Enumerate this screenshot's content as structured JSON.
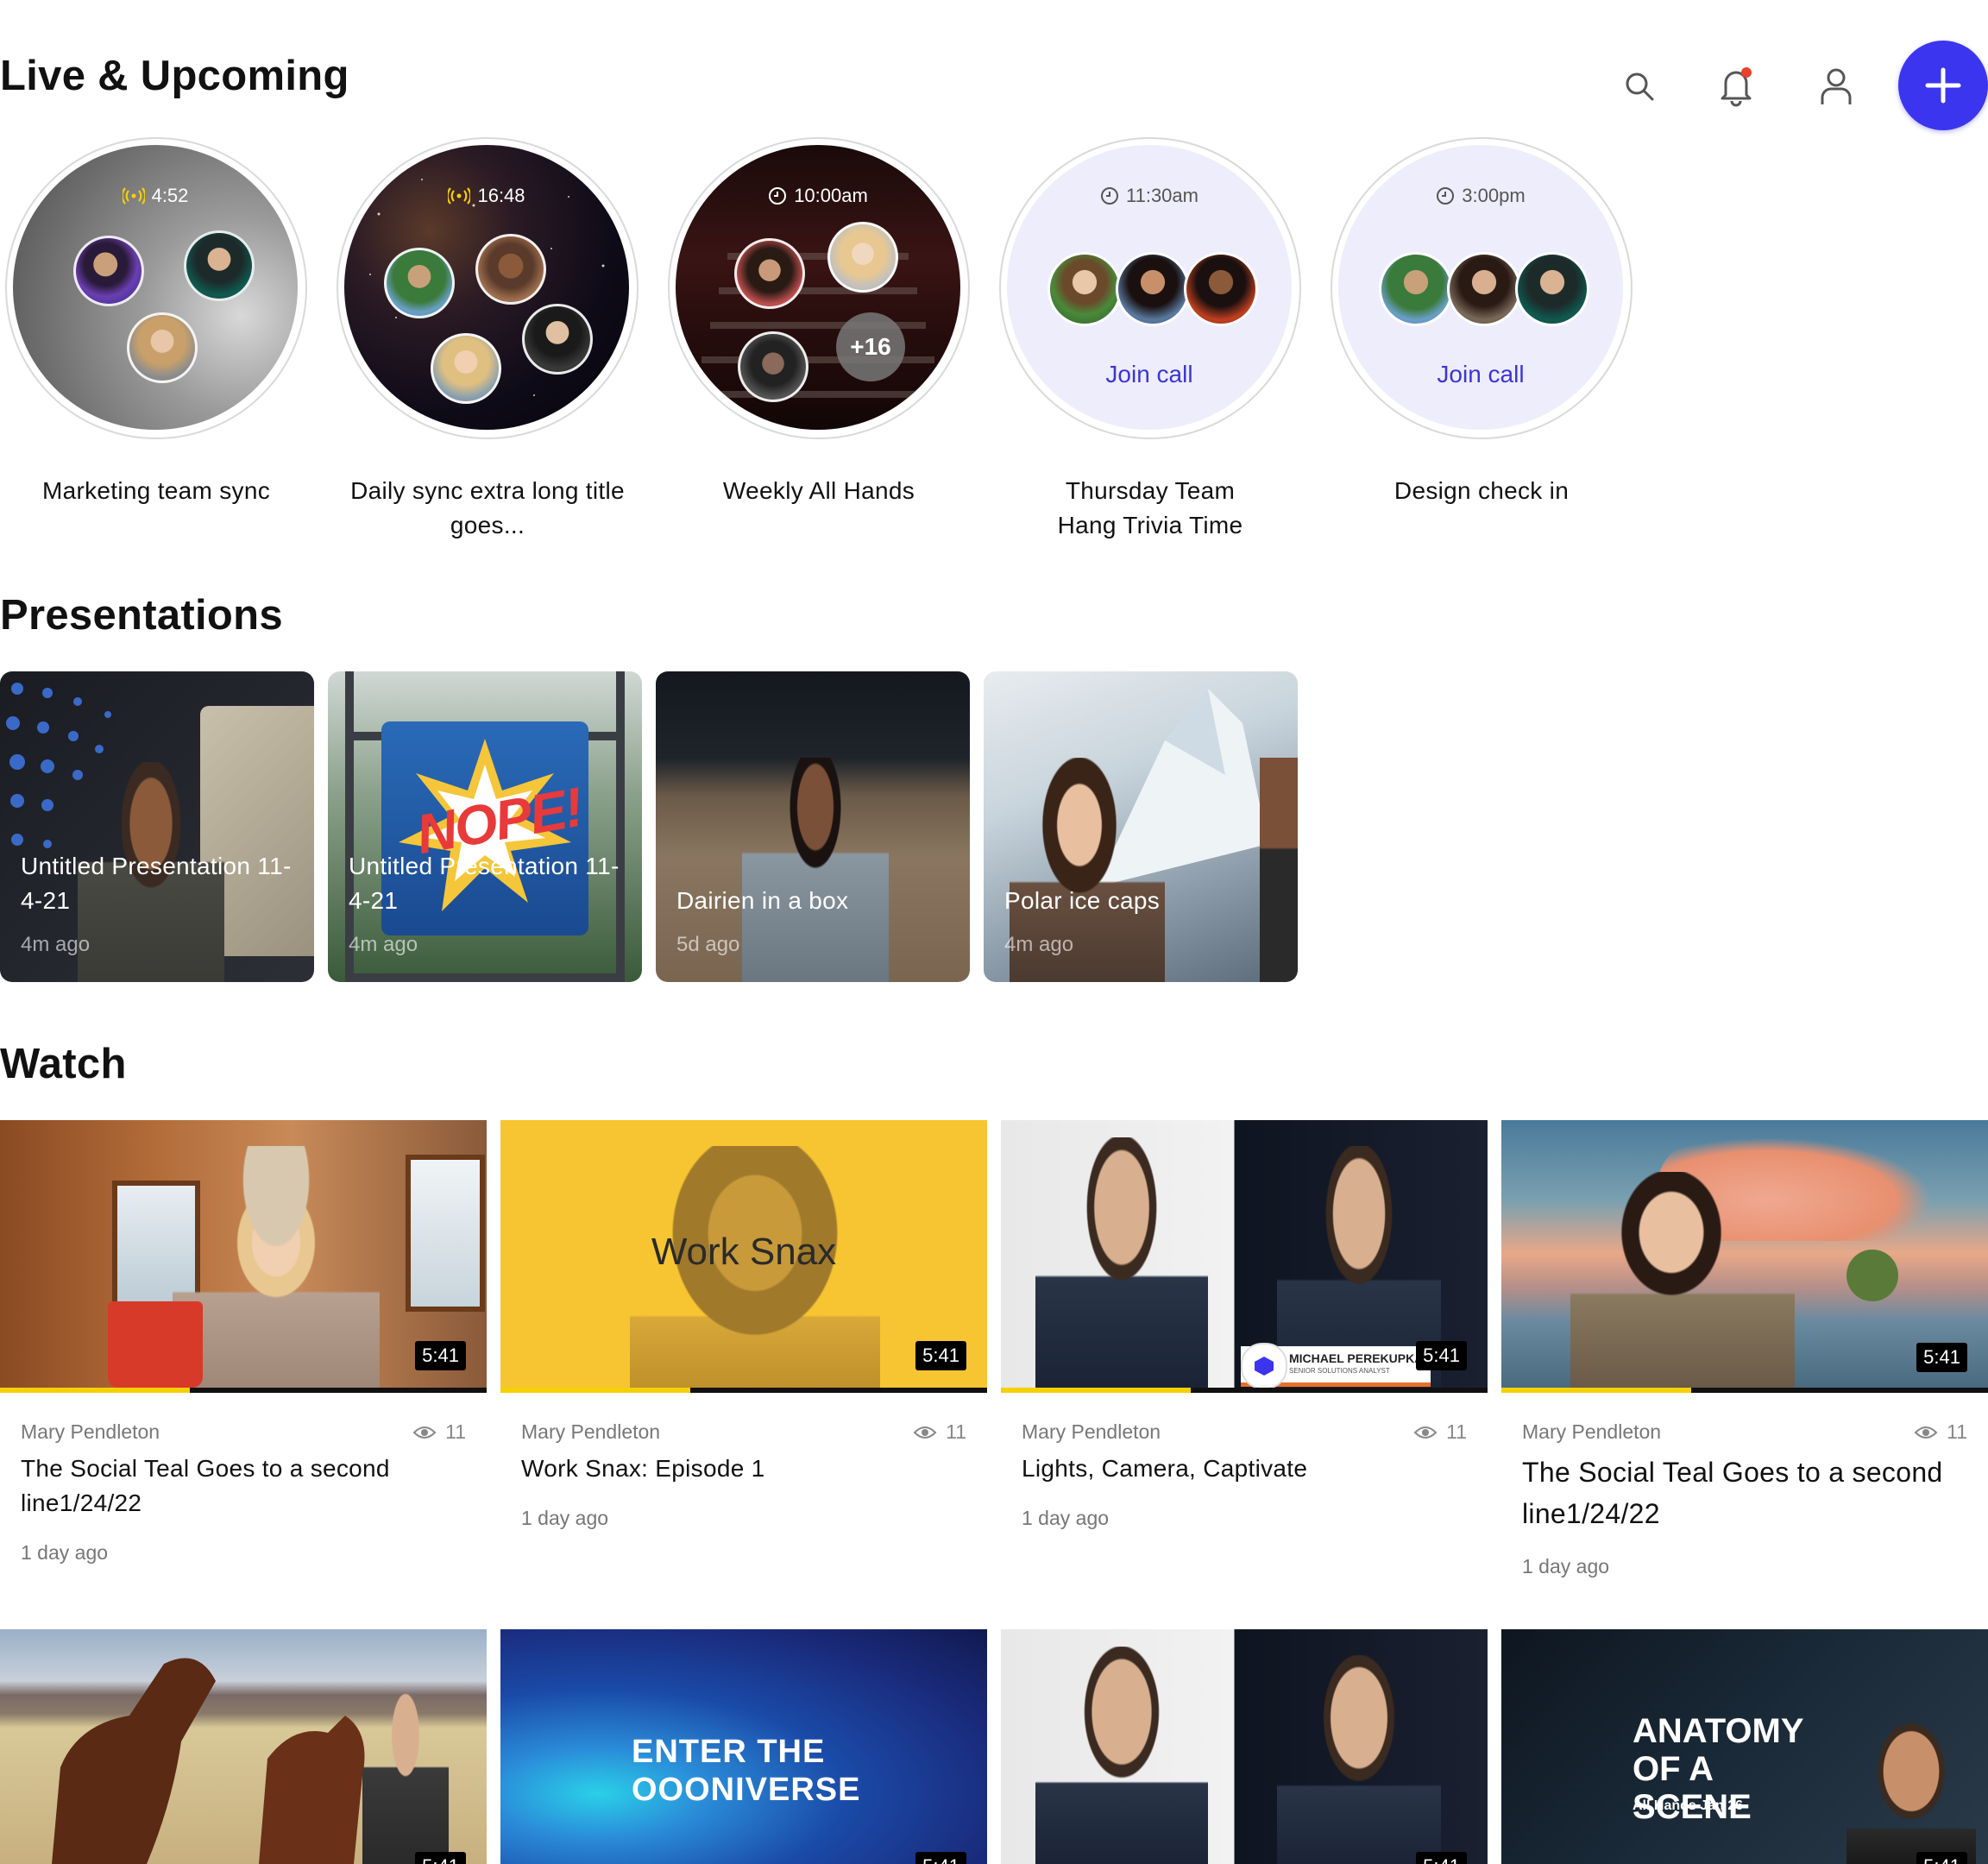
{
  "header": {
    "title": "Live & Upcoming",
    "icons": [
      "search-icon",
      "bell-icon",
      "user-icon",
      "plus-icon"
    ],
    "notification_dot_color": "#e8412c",
    "accent": "#3b35f0"
  },
  "live": [
    {
      "time": "4:52",
      "status": "live",
      "label": "Marketing team sync"
    },
    {
      "time": "16:48",
      "status": "live",
      "label": "Daily sync extra long title goes..."
    },
    {
      "time": "10:00am",
      "status": "scheduled",
      "extra": "+16",
      "label": "Weekly All Hands"
    },
    {
      "time": "11:30am",
      "status": "upcoming",
      "action": "Join call",
      "label": "Thursday Team Hang Trivia Time"
    },
    {
      "time": "3:00pm",
      "status": "upcoming",
      "action": "Join call",
      "label": "Design check in"
    }
  ],
  "presentations": {
    "title": "Presentations",
    "items": [
      {
        "title": "Untitled Presentation 11-4-21",
        "time": "4m ago"
      },
      {
        "title": "Untitled Presentation 11-4-21",
        "time": "4m ago",
        "overlay": "NOPE!"
      },
      {
        "title": "Dairien in a box",
        "time": "5d ago"
      },
      {
        "title": "Polar ice caps",
        "time": "4m ago"
      }
    ]
  },
  "watch": {
    "title": "Watch",
    "items": [
      {
        "author": "Mary Pendleton",
        "views": "11",
        "title": "The Social Teal Goes to a second line1/24/22",
        "time": "1 day ago",
        "duration": "5:41",
        "progress": 0.39
      },
      {
        "author": "Mary Pendleton",
        "views": "11",
        "title": "Work Snax: Episode 1",
        "time": "1 day ago",
        "duration": "5:41",
        "progress": 0.39,
        "overlay": "Work Snax"
      },
      {
        "author": "Mary Pendleton",
        "views": "11",
        "title": "Lights, Camera, Captivate",
        "time": "1 day ago",
        "duration": "5:41",
        "progress": 0.39,
        "overlay": "MICHAEL PEREKUPKA",
        "overlay_sub": "SENIOR SOLUTIONS ANALYST"
      },
      {
        "author": "Mary Pendleton",
        "views": "11",
        "title": "The Social Teal Goes to a second line1/24/22",
        "time": "1 day ago",
        "duration": "5:41",
        "progress": 0.39
      }
    ],
    "row2": [
      {
        "duration": "5:41"
      },
      {
        "duration": "5:41",
        "overlay": "ENTER THE OOONIVERSE"
      },
      {
        "duration": "5:41"
      },
      {
        "duration": "5:41",
        "overlay": "ANATOMY OF A SCENE",
        "overlay_sub": "All Hands Jan 26"
      }
    ]
  }
}
